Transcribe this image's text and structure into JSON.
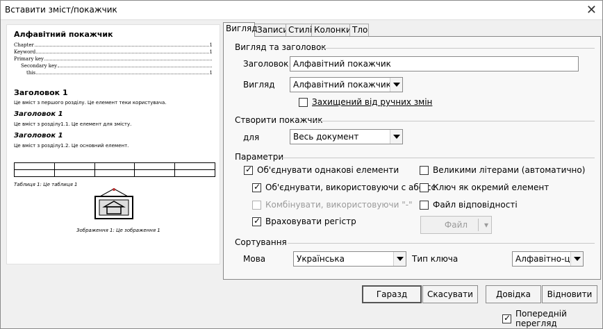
{
  "window": {
    "title": "Вставити зміст/покажчик"
  },
  "preview": {
    "index_title": "Алфавітний покажчик",
    "index_entries": [
      {
        "text": "Chapter",
        "page": "1"
      },
      {
        "text": "Keyword",
        "page": "1"
      },
      {
        "text": "Primary key",
        "page": ""
      },
      {
        "text": "Secondary key",
        "page": ""
      },
      {
        "text": "this",
        "page": "1"
      }
    ],
    "heading1": "Заголовок 1",
    "heading1_text": "Це вміст з першого розділу. Це елемент теки користувача.",
    "heading2a": "Заголовок 1",
    "heading2a_text": "Це вміст з розділу1.1. Це елемент для змісту.",
    "heading2b": "Заголовок 1",
    "heading2b_text": "Це вміст з розділу1.2. Це основний елемент.",
    "table_caption": "Таблиця 1: Це таблиця 1",
    "image_caption": "Зображення 1: Це зображення 1"
  },
  "tabs": [
    "Вигляд",
    "Записи",
    "Стилі",
    "Колонки",
    "Тло"
  ],
  "type_section": {
    "header": "Вигляд та заголовок",
    "title_label": "Заголовок",
    "title_value": "Алфавітний покажчик",
    "type_label": "Вигляд",
    "type_value": "Алфавітний покажчик",
    "protected_label": "Захищений від ручних змін"
  },
  "create_section": {
    "header": "Створити покажчик",
    "for_label": "для",
    "for_value": "Весь документ"
  },
  "options_section": {
    "header": "Параметри",
    "combine_identical": "Об'єднувати однакові елементи",
    "combine_pp": "Об'єднувати, використовуючи с або сс",
    "combine_dash": "Комбінувати, використовуючи \"-\"",
    "case_sensitive": "Враховувати регістр",
    "autocapitalize": "Великими літерами (автоматично)",
    "keys_separate": "Ключ як окремий елемент",
    "concordance": "Файл відповідності",
    "file_button": "Файл"
  },
  "sort_section": {
    "header": "Сортування",
    "language_label": "Мова",
    "language_value": "Українська",
    "key_type_label": "Тип ключа",
    "key_type_value": "Алфавітно-цифрове"
  },
  "buttons": {
    "ok": "Гаразд",
    "cancel": "Скасувати",
    "help": "Довідка",
    "reset": "Відновити"
  },
  "preview_toggle": "Попередній перегляд"
}
